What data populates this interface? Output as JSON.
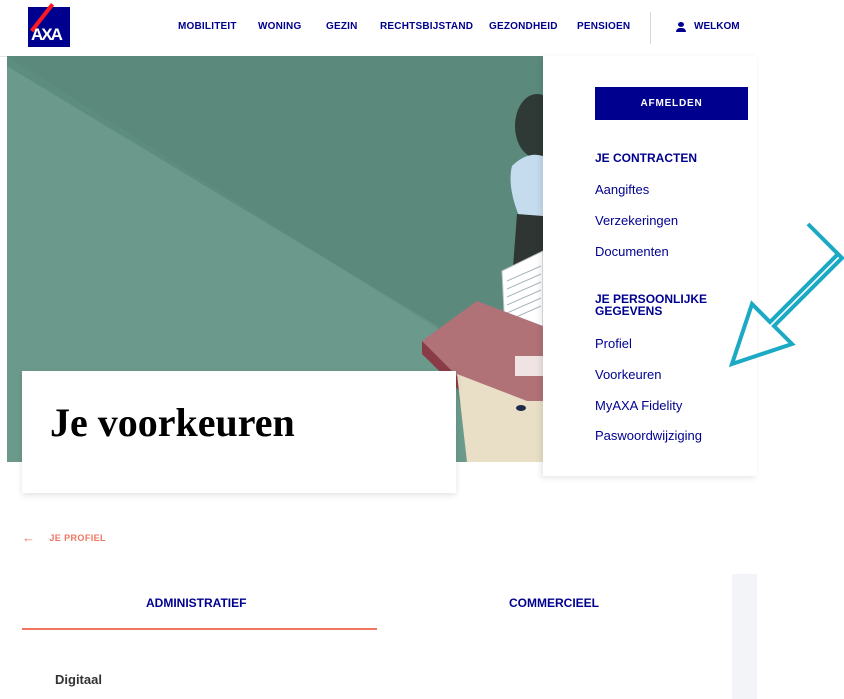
{
  "header": {
    "logo_text": "AXA",
    "nav": [
      "MOBILITEIT",
      "WONING",
      "GEZIN",
      "RECHTSBIJSTAND",
      "GEZONDHEID",
      "PENSIOEN"
    ],
    "welkom": "WELKOM"
  },
  "hero": {
    "title": "Je voorkeuren"
  },
  "panel": {
    "logout": "AFMELDEN",
    "contracts_title": "JE CONTRACTEN",
    "contracts": [
      "Aangiftes",
      "Verzekeringen",
      "Documenten"
    ],
    "personal_title": "JE PERSOONLIJKE GEGEVENS",
    "personal": [
      "Profiel",
      "Voorkeuren",
      "MyAXA Fidelity",
      "Paswoordwijziging"
    ]
  },
  "back_link": "JE PROFIEL",
  "tabs": [
    "ADMINISTRATIEF",
    "COMMERCIEEL"
  ],
  "section_label": "Digitaal",
  "colors": {
    "brand_blue": "#00008f",
    "accent_coral": "#f07662",
    "hero_green": "#5b8a7c",
    "annotation_teal": "#1ba9c4"
  }
}
